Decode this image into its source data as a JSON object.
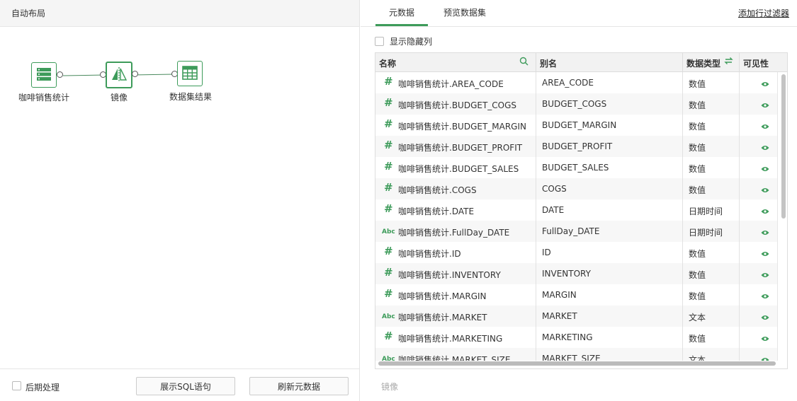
{
  "left_panel": {
    "header": "自动布局",
    "nodes": [
      {
        "label": "咖啡销售统计",
        "icon": "database-icon"
      },
      {
        "label": "镜像",
        "icon": "mirror-icon"
      },
      {
        "label": "数据集结果",
        "icon": "table-icon"
      }
    ],
    "footer": {
      "post_process_label": "后期处理",
      "show_sql_label": "展示SQL语句",
      "refresh_label": "刷新元数据"
    }
  },
  "right_panel": {
    "tabs": [
      {
        "label": "元数据",
        "active": true
      },
      {
        "label": "预览数据集",
        "active": false
      }
    ],
    "filter_link": "添加行过滤器",
    "show_hidden_label": "显示隐藏列",
    "columns": {
      "name": "名称",
      "alias": "别名",
      "type": "数据类型",
      "visible": "可见性"
    },
    "rows": [
      {
        "type_icon": "#",
        "name": "咖啡销售统计.AREA_CODE",
        "alias": "AREA_CODE",
        "type": "数值"
      },
      {
        "type_icon": "#",
        "name": "咖啡销售统计.BUDGET_COGS",
        "alias": "BUDGET_COGS",
        "type": "数值"
      },
      {
        "type_icon": "#",
        "name": "咖啡销售统计.BUDGET_MARGIN",
        "alias": "BUDGET_MARGIN",
        "type": "数值"
      },
      {
        "type_icon": "#",
        "name": "咖啡销售统计.BUDGET_PROFIT",
        "alias": "BUDGET_PROFIT",
        "type": "数值"
      },
      {
        "type_icon": "#",
        "name": "咖啡销售统计.BUDGET_SALES",
        "alias": "BUDGET_SALES",
        "type": "数值"
      },
      {
        "type_icon": "#",
        "name": "咖啡销售统计.COGS",
        "alias": "COGS",
        "type": "数值"
      },
      {
        "type_icon": "#",
        "name": "咖啡销售统计.DATE",
        "alias": "DATE",
        "type": "日期时间"
      },
      {
        "type_icon": "Abc",
        "name": "咖啡销售统计.FullDay_DATE",
        "alias": "FullDay_DATE",
        "type": "日期时间"
      },
      {
        "type_icon": "#",
        "name": "咖啡销售统计.ID",
        "alias": "ID",
        "type": "数值"
      },
      {
        "type_icon": "#",
        "name": "咖啡销售统计.INVENTORY",
        "alias": "INVENTORY",
        "type": "数值"
      },
      {
        "type_icon": "#",
        "name": "咖啡销售统计.MARGIN",
        "alias": "MARGIN",
        "type": "数值"
      },
      {
        "type_icon": "Abc",
        "name": "咖啡销售统计.MARKET",
        "alias": "MARKET",
        "type": "文本"
      },
      {
        "type_icon": "#",
        "name": "咖啡销售统计.MARKETING",
        "alias": "MARKETING",
        "type": "数值"
      },
      {
        "type_icon": "Abc",
        "name": "咖啡销售统计.MARKET_SIZE",
        "alias": "MARKET_SIZE",
        "type": "文本"
      }
    ],
    "status_label": "镜像"
  },
  "colors": {
    "accent": "#3d9b5a"
  }
}
